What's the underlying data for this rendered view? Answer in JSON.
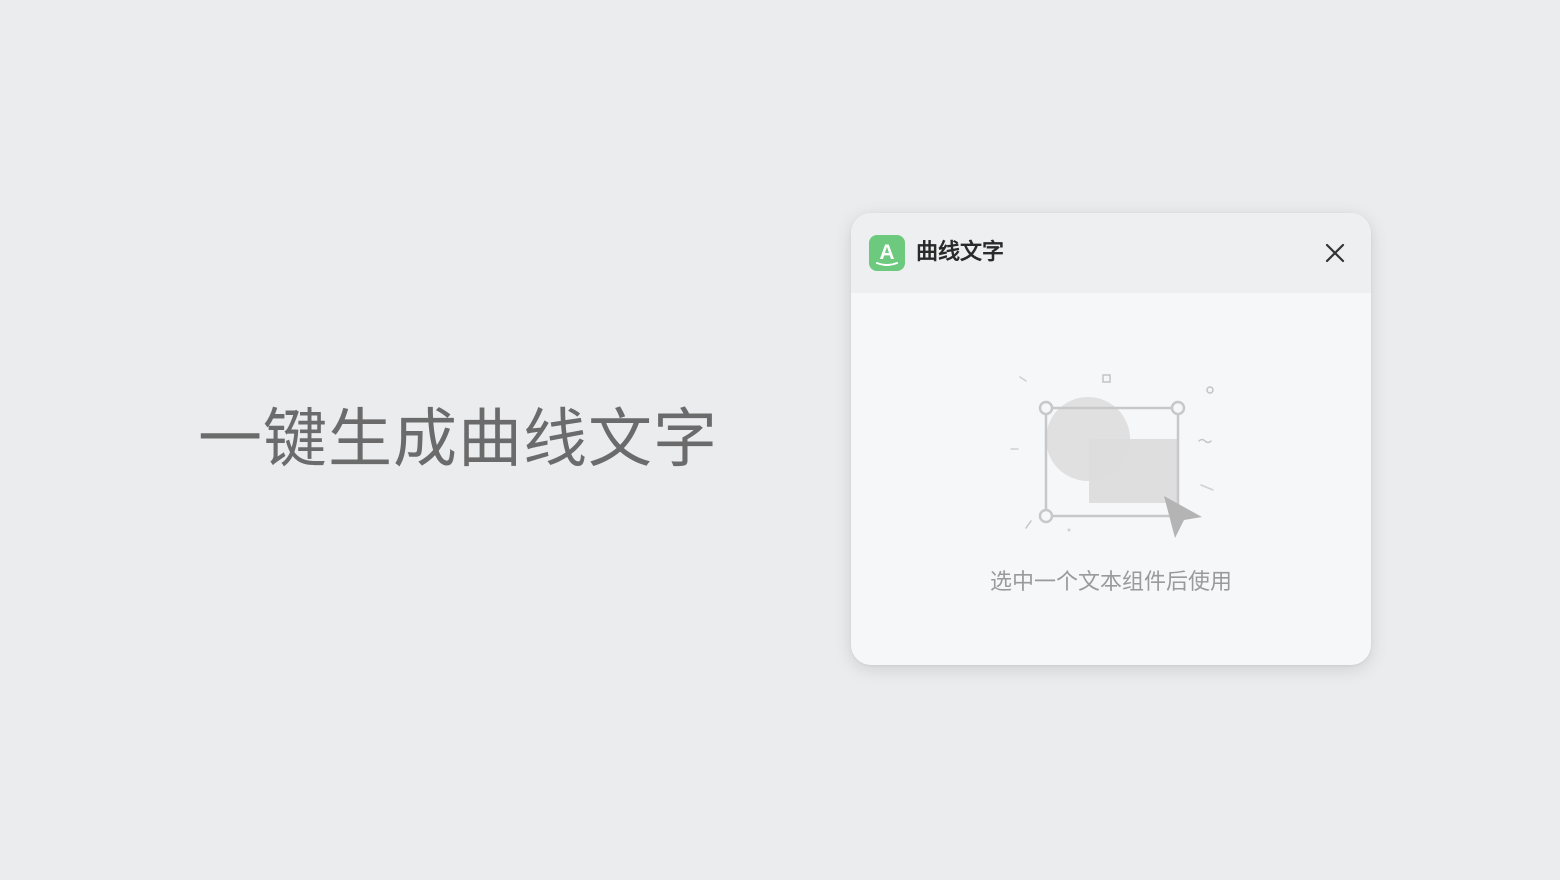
{
  "headline": "一键生成曲线文字",
  "panel": {
    "title": "曲线文字",
    "app_icon": "curved-text-app-icon",
    "app_icon_color": "#6dc97d",
    "close_icon": "close-icon",
    "empty_state": {
      "illustration": "select-text-illustration",
      "hint": "选中一个文本组件后使用"
    }
  },
  "colors": {
    "background": "#ebecee",
    "panel_bg": "#f6f7f9",
    "header_bg": "#eeeff1",
    "headline_text": "#6b6b6b",
    "hint_text": "#9a9a9a"
  }
}
